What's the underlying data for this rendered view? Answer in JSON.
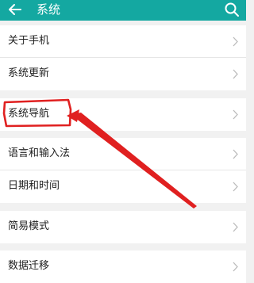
{
  "header": {
    "title": "系统",
    "accent_color": "#14a8a1",
    "back_icon": "arrow-left-icon",
    "search_icon": "search-icon"
  },
  "settings": {
    "group1": [
      {
        "label": "关于手机"
      },
      {
        "label": "系统更新"
      }
    ],
    "group2": [
      {
        "label": "系统导航"
      }
    ],
    "group3": [
      {
        "label": "语言和输入法"
      },
      {
        "label": "日期和时间"
      }
    ],
    "group4": [
      {
        "label": "简易模式"
      }
    ],
    "group5": [
      {
        "label": "数据迁移"
      }
    ]
  },
  "annotation": {
    "color": "#e02020",
    "highlighted_item": "系统导航"
  }
}
